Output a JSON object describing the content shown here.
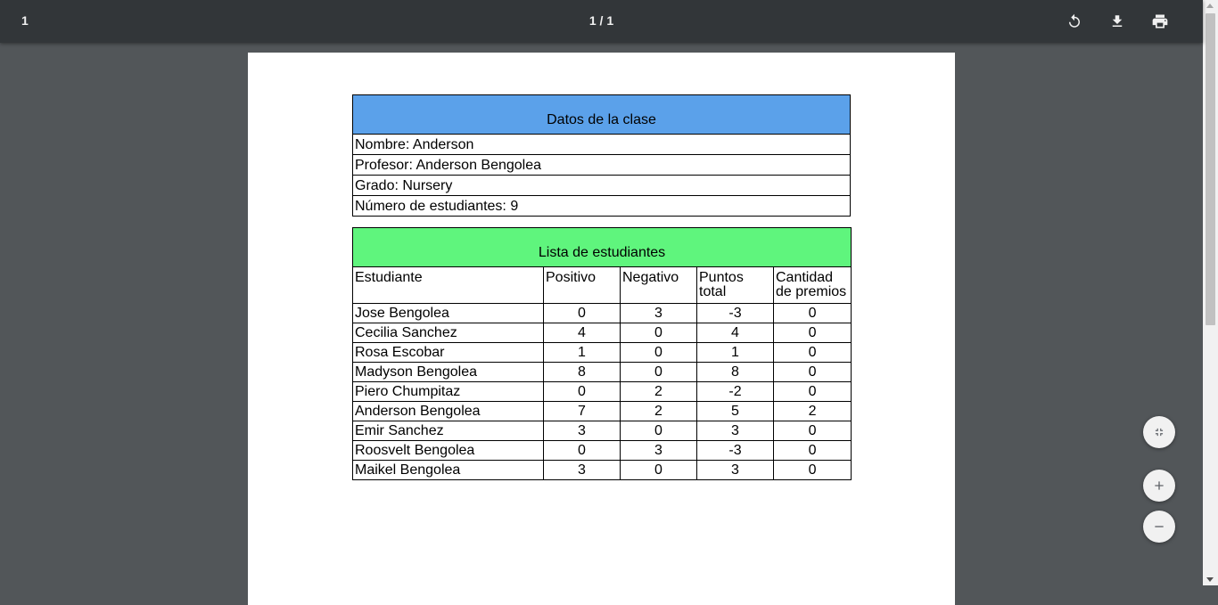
{
  "toolbar": {
    "title": "1",
    "page_indicator": "1 / 1",
    "rotate_icon": "rotate-icon",
    "download_icon": "download-icon",
    "print_icon": "print-icon"
  },
  "class_info": {
    "header": "Datos de la clase",
    "lines": [
      "Nombre: Anderson",
      "Profesor: Anderson Bengolea",
      "Grado: Nursery",
      "Número de estudiantes: 9"
    ]
  },
  "student_list": {
    "header": "Lista de estudiantes",
    "columns": [
      "Estudiante",
      "Positivo",
      "Negativo",
      "Puntos total",
      "Cantidad de premios"
    ],
    "rows": [
      [
        "Jose Bengolea",
        "0",
        "3",
        "-3",
        "0"
      ],
      [
        "Cecilia Sanchez",
        "4",
        "0",
        "4",
        "0"
      ],
      [
        "Rosa Escobar",
        "1",
        "0",
        "1",
        "0"
      ],
      [
        "Madyson Bengolea",
        "8",
        "0",
        "8",
        "0"
      ],
      [
        "Piero Chumpitaz",
        "0",
        "2",
        "-2",
        "0"
      ],
      [
        "Anderson Bengolea",
        "7",
        "2",
        "5",
        "2"
      ],
      [
        "Emir Sanchez",
        "3",
        "0",
        "3",
        "0"
      ],
      [
        "Roosvelt Bengolea",
        "0",
        "3",
        "-3",
        "0"
      ],
      [
        "Maikel Bengolea",
        "3",
        "0",
        "3",
        "0"
      ]
    ]
  },
  "zoom_controls": {
    "fit_icon": "fit-to-page-icon",
    "zoom_in_icon": "zoom-in-icon",
    "zoom_out_icon": "zoom-out-icon"
  },
  "colors": {
    "toolbar_bg": "#323639",
    "viewer_bg": "#525659",
    "class_header_bg": "#5ba1ea",
    "student_header_bg": "#5ff57d"
  }
}
